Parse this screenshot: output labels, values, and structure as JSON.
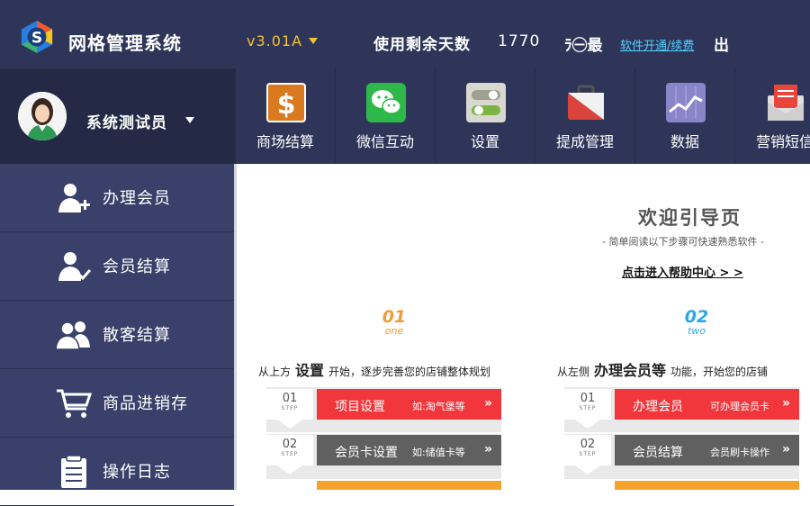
{
  "header": {
    "app_title": "网格管理系统",
    "version": "v3.01A",
    "remain_label": "使用剩余天数",
    "remain_value": "1770",
    "min_text": "ﾗ㊀最",
    "renew_link": "软件开通/续费",
    "exit_text": "出"
  },
  "user": {
    "name": "系统测试员"
  },
  "modules": [
    {
      "label": "商场结算",
      "icon": "dollar-icon"
    },
    {
      "label": "微信互动",
      "icon": "wechat-icon"
    },
    {
      "label": "设置",
      "icon": "toggle-settings-icon"
    },
    {
      "label": "提成管理",
      "icon": "briefcase-icon"
    },
    {
      "label": "数据",
      "icon": "chart-icon"
    },
    {
      "label": "营销短信",
      "icon": "mail-icon"
    }
  ],
  "sidebar": [
    {
      "label": "办理会员",
      "icon": "add-user-icon"
    },
    {
      "label": "会员结算",
      "icon": "member-check-icon"
    },
    {
      "label": "散客结算",
      "icon": "group-icon"
    },
    {
      "label": "商品进销存",
      "icon": "cart-icon"
    },
    {
      "label": "操作日志",
      "icon": "clipboard-icon"
    }
  ],
  "welcome": {
    "title": "欢迎引导页",
    "subtitle": "- 简单阅读以下步骤可快速熟悉软件 -",
    "help_link": "点击进入帮助中心 > >"
  },
  "steps": [
    {
      "badge_num": "01",
      "badge_word": "one",
      "desc_prefix": "从上方",
      "desc_bold": "设置",
      "desc_suffix": "开始，逐步完善您的店铺整体规划",
      "items": [
        {
          "num": "01",
          "step": "STEP",
          "label": "项目设置",
          "hint": "如:淘气堡等"
        },
        {
          "num": "02",
          "step": "STEP",
          "label": "会员卡设置",
          "hint": "如:储值卡等"
        }
      ]
    },
    {
      "badge_num": "02",
      "badge_word": "two",
      "desc_prefix": "从左侧",
      "desc_bold": "办理会员等",
      "desc_suffix": "功能，开始您的店铺",
      "items": [
        {
          "num": "01",
          "step": "STEP",
          "label": "办理会员",
          "hint": "可办理会员卡"
        },
        {
          "num": "02",
          "step": "STEP",
          "label": "会员结算",
          "hint": "会员刷卡操作"
        }
      ]
    }
  ],
  "colors": {
    "topbar": "#2f3558",
    "sidebar": "#39406a",
    "accent_red": "#f2373c",
    "accent_orange": "#f5a32a",
    "version_gold": "#f2c230",
    "link_cyan": "#4fd0ff"
  }
}
